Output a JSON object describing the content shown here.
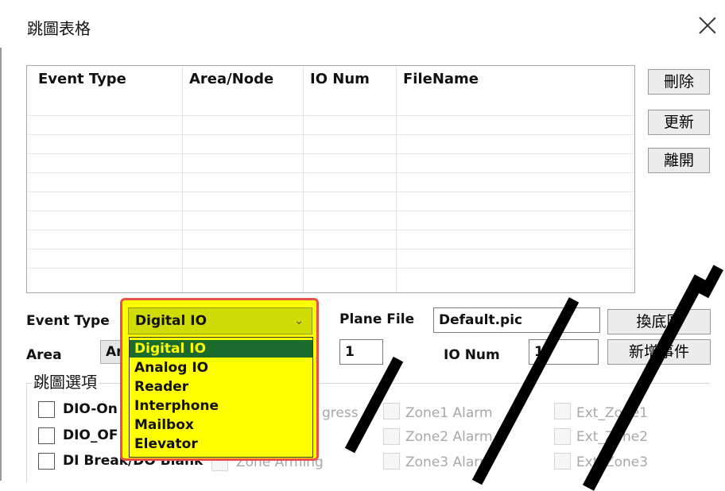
{
  "window": {
    "title": "跳圖表格"
  },
  "table": {
    "columns": [
      "Event Type",
      "Area/Node",
      "IO Num",
      "FileName"
    ],
    "rows": []
  },
  "side_buttons": {
    "delete": "刪除",
    "update": "更新",
    "leave": "離開"
  },
  "form": {
    "event_type_label": "Event Type",
    "event_type_value": "Digital IO",
    "plane_file_label": "Plane File",
    "plane_file_value": "Default.pic",
    "change_bg_button": "換底圖",
    "area_label": "Area",
    "area_value": "Area",
    "area_num_value": "1",
    "io_num_label": "IO Num",
    "io_num_value": "1",
    "add_event_button": "新增事件"
  },
  "dropdown": {
    "options": [
      "Digital IO",
      "Analog IO",
      "Reader",
      "Interphone",
      "Mailbox",
      "Elevator"
    ],
    "selected": "Digital IO"
  },
  "options_group": {
    "label": "跳圖選項",
    "col1": [
      "DIO-On",
      "DIO_OF",
      "DI Break/DO Blank"
    ],
    "col2": [
      "gress",
      "",
      "Zone Arming"
    ],
    "col3": [
      "Zone1 Alarm",
      "Zone2 Alarm",
      "Zone3 Alarm"
    ],
    "col4": [
      "Ext_Zone1",
      "Ext_Zone2",
      "Ext_Zone3"
    ]
  },
  "icons": {
    "close": "close-icon",
    "chevron": "chevron-down-icon"
  },
  "colors": {
    "dropdown_bg": "#ffff00",
    "dropdown_selected": "#1b6b2c",
    "dropdown_border": "#e8524a"
  }
}
